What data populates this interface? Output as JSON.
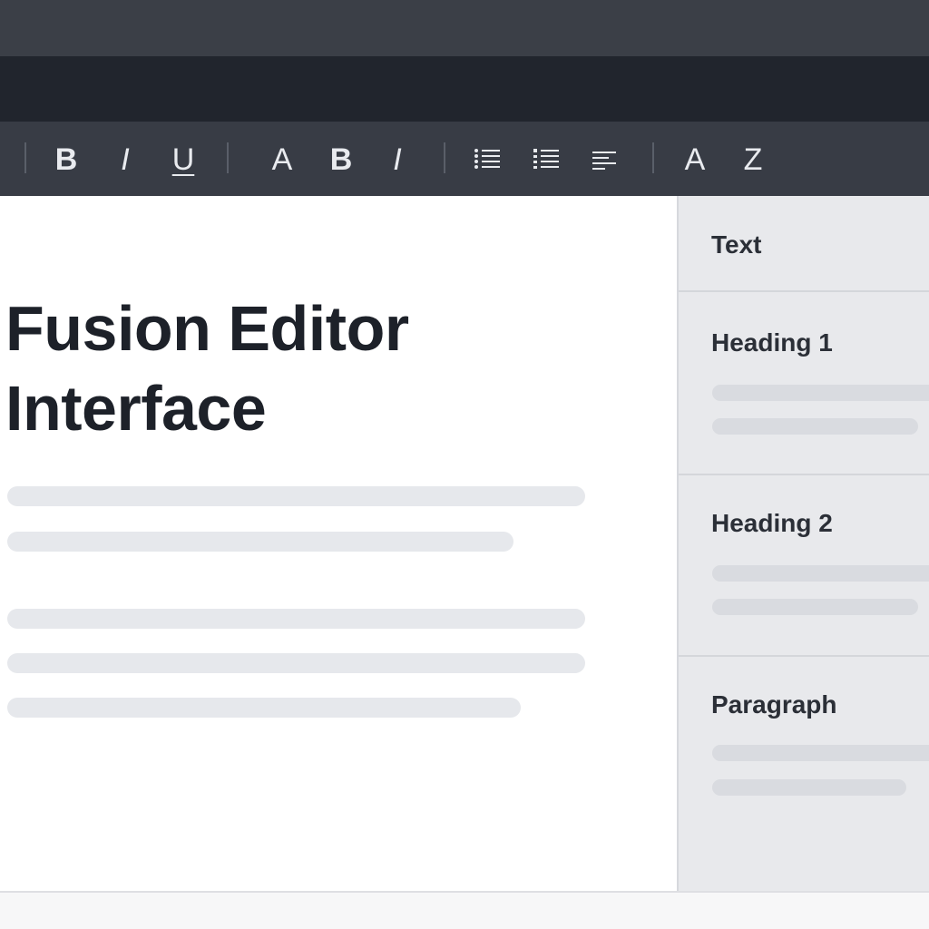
{
  "toolbar": {
    "buttons": [
      {
        "label": "B",
        "name": "bold"
      },
      {
        "label": "I",
        "name": "italic"
      },
      {
        "label": "U",
        "name": "underline"
      },
      {
        "label": "A",
        "name": "font"
      },
      {
        "label": "B",
        "name": "bold-alt"
      },
      {
        "label": "I",
        "name": "italic-alt"
      },
      {
        "icon": "unordered-list-icon"
      },
      {
        "icon": "ordered-list-icon"
      },
      {
        "icon": "align-left-icon"
      },
      {
        "label": "A",
        "name": "font-size"
      },
      {
        "label": "Z",
        "name": "text-style"
      }
    ]
  },
  "document": {
    "title_line1": "Fusion Editor",
    "title_line2": "Interface"
  },
  "panel": {
    "items": [
      {
        "label": "Text"
      },
      {
        "label": "Heading 1"
      },
      {
        "label": "Heading 2"
      },
      {
        "label": "Paragraph"
      }
    ]
  },
  "colors": {
    "toolbar_bg": "#383c45",
    "menubar_bg": "#21252d",
    "panel_bg": "#e8e9ec",
    "placeholder": "#e6e8ec",
    "text": "#1d2129"
  }
}
